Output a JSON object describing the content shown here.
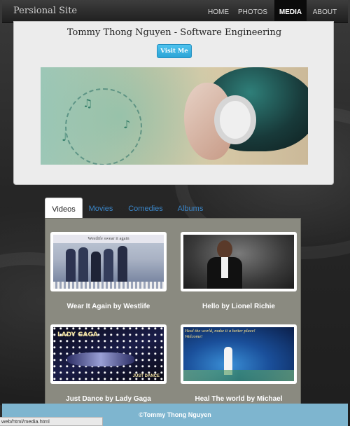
{
  "nav": {
    "brand": "Persional Site",
    "items": [
      {
        "label": "HOME",
        "active": false
      },
      {
        "label": "PHOTOS",
        "active": false
      },
      {
        "label": "MEDIA",
        "active": true
      },
      {
        "label": "ABOUT",
        "active": false
      }
    ]
  },
  "hero": {
    "title": "Tommy Thong Nguyen - Software Engineering",
    "button_label": "Visit Me"
  },
  "tabs": [
    {
      "label": "Videos",
      "active": true
    },
    {
      "label": "Movies",
      "active": false
    },
    {
      "label": "Comedies",
      "active": false
    },
    {
      "label": "Albums",
      "active": false
    }
  ],
  "videos": [
    {
      "title": "Wear It Again by Westlife",
      "thumb_caption": "Westlife swear it again"
    },
    {
      "title": "Hello by Lionel Richie"
    },
    {
      "title": "Just Dance by Lady Gaga",
      "thumb_caption_top": "LADY GAGA",
      "thumb_caption_bottom": "JUST DANCE"
    },
    {
      "title": "Heal The world by Michael",
      "thumb_caption": "Heal the world, make it a better place! Welcome!"
    }
  ],
  "footer": {
    "text": "©Tommy Thong Nguyen"
  },
  "status_bar": {
    "url": "web/html/media.html"
  },
  "colors": {
    "accent_button": "#2ba4d6",
    "tab_link": "#3b86c8",
    "footer_bg": "#7eb5cf",
    "panel_bg": "#8a8a80"
  }
}
